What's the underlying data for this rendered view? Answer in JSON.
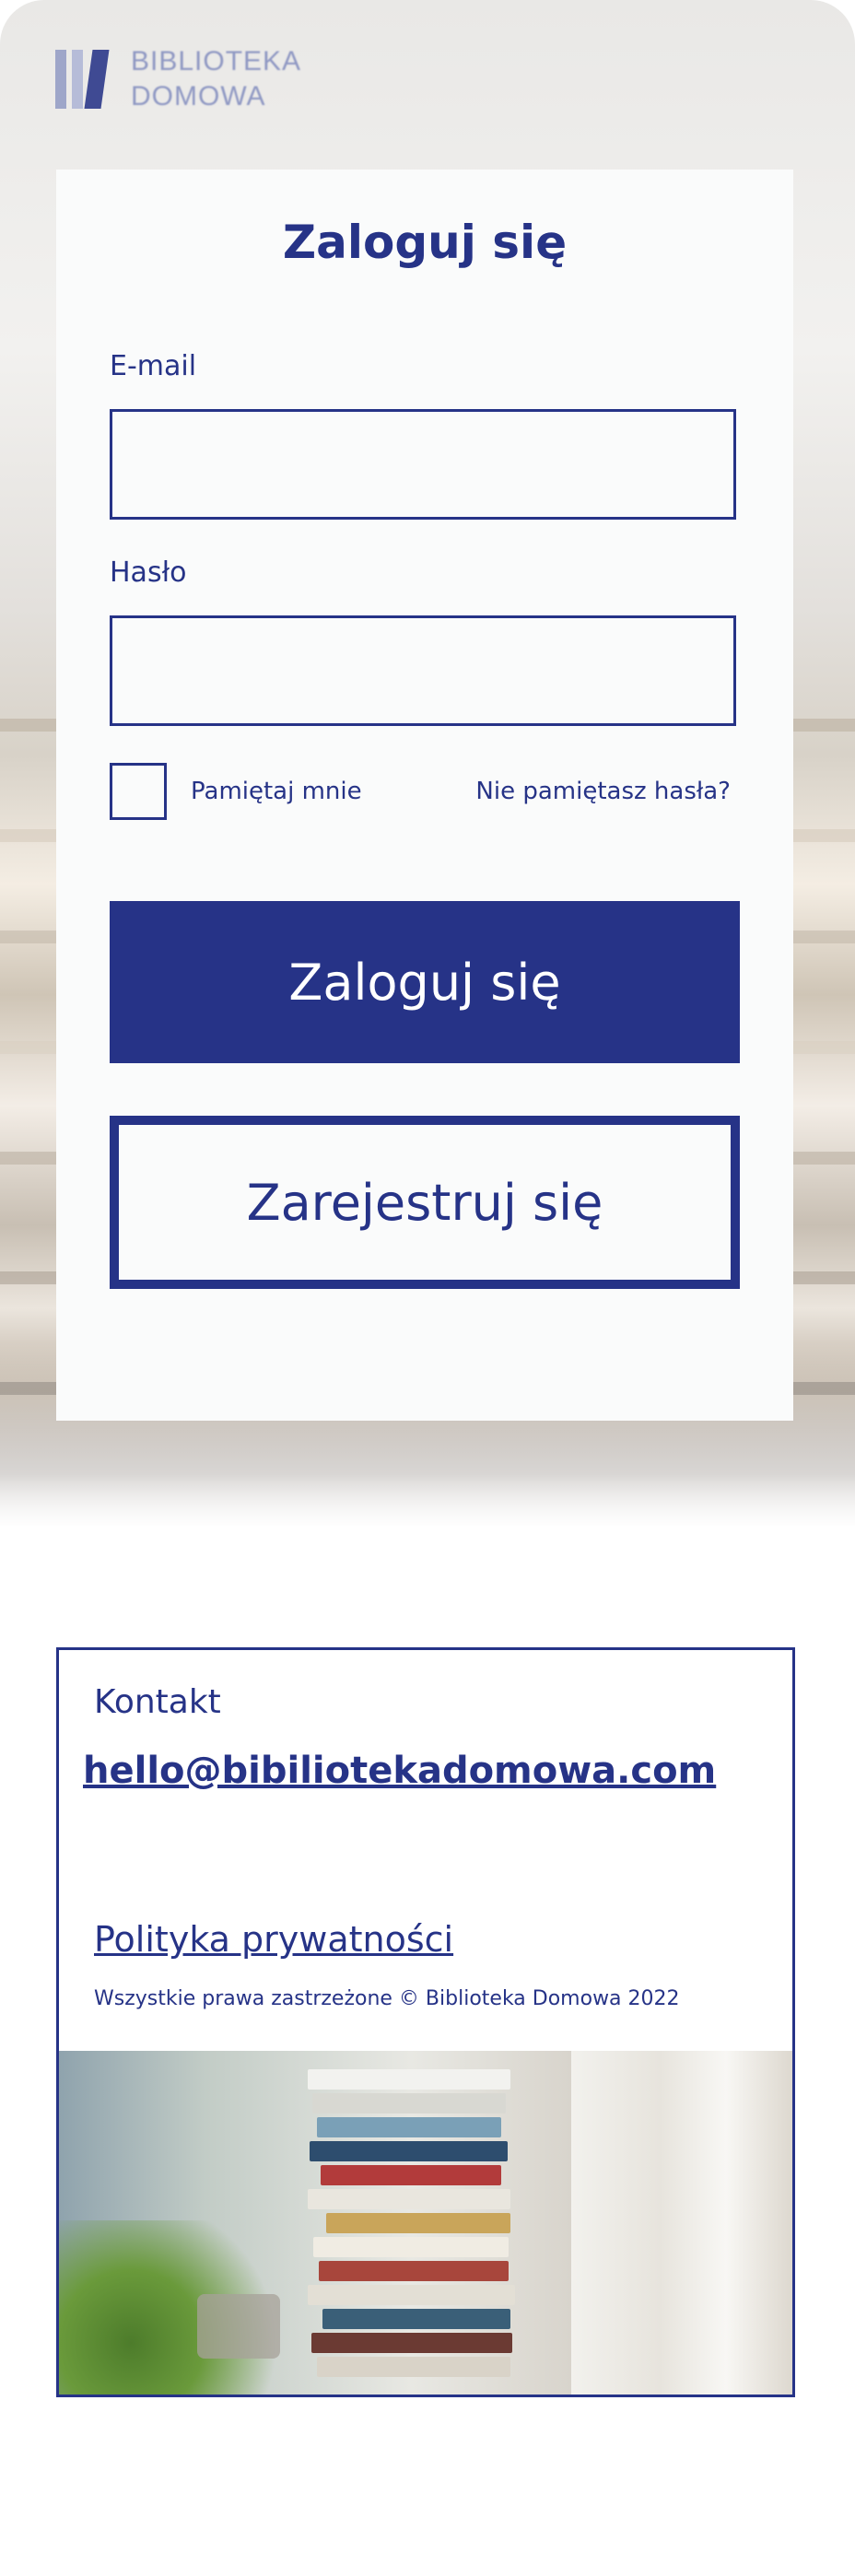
{
  "brand": {
    "name_line1": "BIBLIOTEKA",
    "name_line2": "DOMOWA"
  },
  "login": {
    "title": "Zaloguj się",
    "email_label": "E-mail",
    "email_value": "",
    "password_label": "Hasło",
    "password_value": "",
    "remember_label": "Pamiętaj mnie",
    "remember_checked": false,
    "forgot_label": "Nie pamiętasz hasła?",
    "login_button": "Zaloguj się",
    "register_button": "Zarejestruj się"
  },
  "footer": {
    "contact_label": "Kontakt",
    "email": "hello@bibiliotekadomowa.com",
    "privacy_link": "Polityka prywatności",
    "rights": "Wszystkie prawa zastrzeżone © Biblioteka Domowa 2022"
  },
  "colors": {
    "primary": "#263387",
    "card_bg": "#fafbfb",
    "text_on_primary": "#ffffff"
  }
}
